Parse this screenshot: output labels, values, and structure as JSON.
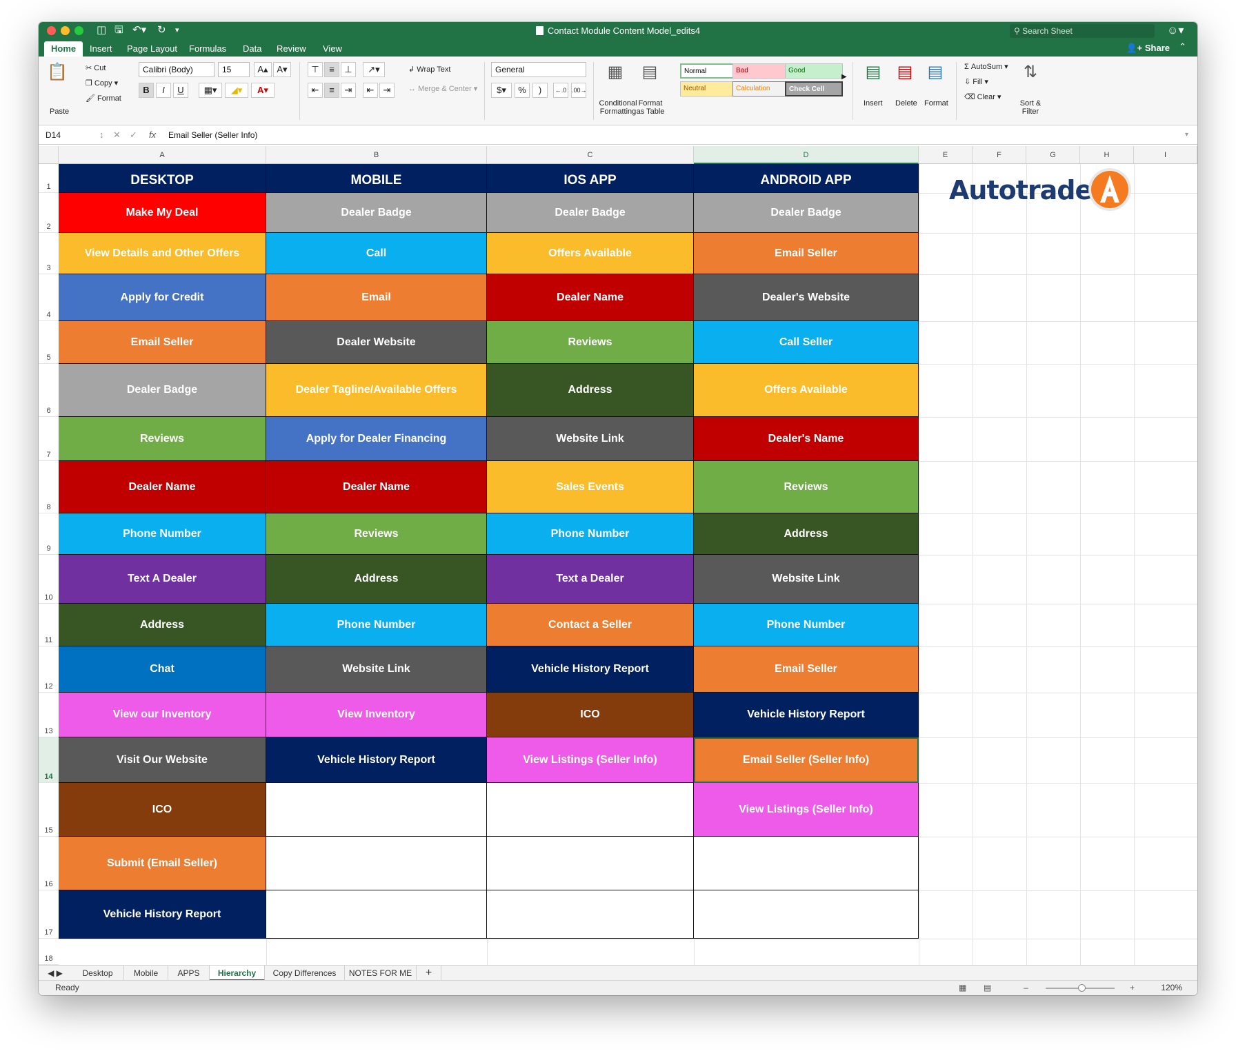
{
  "window": {
    "title": "Contact Module Content Model_edits4",
    "search_placeholder": "Search Sheet",
    "share_label": "Share",
    "menu_tabs": [
      "Home",
      "Insert",
      "Page Layout",
      "Formulas",
      "Data",
      "Review",
      "View"
    ],
    "active_tab": "Home"
  },
  "ribbon": {
    "paste": "Paste",
    "cut": "Cut",
    "copy": "Copy",
    "format_painter": "Format",
    "font_name": "Calibri (Body)",
    "font_size": "15",
    "wrap_text": "Wrap Text",
    "merge_center": "Merge & Center",
    "number_format": "General",
    "currency": "$",
    "percent": "%",
    "comma": ")",
    "conditional_formatting_1": "Conditional",
    "conditional_formatting_2": "Formatting",
    "format_as_table_1": "Format",
    "format_as_table_2": "as Table",
    "styles": [
      "Normal",
      "Bad",
      "Good",
      "Neutral",
      "Calculation",
      "Check Cell"
    ],
    "insert": "Insert",
    "delete": "Delete",
    "format": "Format",
    "autosum": "AutoSum",
    "fill": "Fill",
    "clear": "Clear",
    "sort_filter_1": "Sort &",
    "sort_filter_2": "Filter"
  },
  "formula_bar": {
    "cell_ref": "D14",
    "fx": "fx",
    "value": "Email Seller (Seller Info)"
  },
  "columns": [
    "A",
    "B",
    "C",
    "D",
    "E",
    "F",
    "G",
    "H",
    "I"
  ],
  "selected_column": "D",
  "selected_row": "14",
  "rows": [
    "1",
    "2",
    "3",
    "4",
    "5",
    "6",
    "7",
    "8",
    "9",
    "10",
    "11",
    "12",
    "13",
    "14",
    "15",
    "16",
    "17",
    "18"
  ],
  "logo_text": "Autotrader",
  "colors": {
    "navy": "#002060",
    "red": "#ff0000",
    "darkred": "#c00000",
    "gray": "#a5a5a5",
    "darkgray": "#595959",
    "orange": "#ed7d31",
    "gold": "#fbbc2c",
    "blue": "#4472c4",
    "cyan": "#0aafef",
    "green": "#70ad47",
    "darkgreen": "#375623",
    "purple": "#7030a0",
    "medblue": "#0070c0",
    "magenta": "#ee5be9",
    "brown": "#843c0c",
    "excel_green": "#217346"
  },
  "table": {
    "headers": [
      "DESKTOP",
      "MOBILE",
      "IOS APP",
      "ANDROID APP"
    ],
    "desktop": [
      {
        "text": "Make My Deal",
        "color": "red"
      },
      {
        "text": "View Details and Other Offers",
        "color": "gold"
      },
      {
        "text": "Apply for Credit",
        "color": "blue"
      },
      {
        "text": "Email Seller",
        "color": "orange"
      },
      {
        "text": "Dealer Badge",
        "color": "gray"
      },
      {
        "text": "Reviews",
        "color": "green"
      },
      {
        "text": "Dealer Name",
        "color": "darkred"
      },
      {
        "text": "Phone Number",
        "color": "cyan"
      },
      {
        "text": "Text A Dealer",
        "color": "purple"
      },
      {
        "text": "Address",
        "color": "darkgreen"
      },
      {
        "text": "Chat",
        "color": "medblue"
      },
      {
        "text": "View our Inventory",
        "color": "magenta"
      },
      {
        "text": "Visit Our Website",
        "color": "darkgray"
      },
      {
        "text": "ICO",
        "color": "brown"
      },
      {
        "text": "Submit (Email Seller)",
        "color": "orange"
      },
      {
        "text": "Vehicle History Report",
        "color": "navy"
      }
    ],
    "mobile": [
      {
        "text": "Dealer Badge",
        "color": "gray"
      },
      {
        "text": "Call",
        "color": "cyan"
      },
      {
        "text": "Email",
        "color": "orange"
      },
      {
        "text": "Dealer Website",
        "color": "darkgray"
      },
      {
        "text": "Dealer Tagline/Available Offers",
        "color": "gold"
      },
      {
        "text": "Apply for Dealer Financing",
        "color": "blue"
      },
      {
        "text": "Dealer Name",
        "color": "darkred"
      },
      {
        "text": "Reviews",
        "color": "green"
      },
      {
        "text": "Address",
        "color": "darkgreen"
      },
      {
        "text": "Phone Number",
        "color": "cyan"
      },
      {
        "text": "Website Link",
        "color": "darkgray"
      },
      {
        "text": "View Inventory",
        "color": "magenta"
      },
      {
        "text": "Vehicle History Report",
        "color": "navy"
      }
    ],
    "ios": [
      {
        "text": "Dealer Badge",
        "color": "gray"
      },
      {
        "text": "Offers Available",
        "color": "gold"
      },
      {
        "text": "Dealer Name",
        "color": "darkred"
      },
      {
        "text": "Reviews",
        "color": "green"
      },
      {
        "text": "Address",
        "color": "darkgreen"
      },
      {
        "text": "Website Link",
        "color": "darkgray"
      },
      {
        "text": "Sales Events",
        "color": "gold"
      },
      {
        "text": "Phone Number",
        "color": "cyan"
      },
      {
        "text": "Text a Dealer",
        "color": "purple"
      },
      {
        "text": "Contact a Seller",
        "color": "orange"
      },
      {
        "text": "Vehicle History Report",
        "color": "navy"
      },
      {
        "text": "ICO",
        "color": "brown"
      },
      {
        "text": "View Listings (Seller Info)",
        "color": "magenta"
      }
    ],
    "android": [
      {
        "text": "Dealer Badge",
        "color": "gray"
      },
      {
        "text": "Email Seller",
        "color": "orange"
      },
      {
        "text": "Dealer's Website",
        "color": "darkgray"
      },
      {
        "text": "Call Seller",
        "color": "cyan"
      },
      {
        "text": "Offers Available",
        "color": "gold"
      },
      {
        "text": "Dealer's Name",
        "color": "darkred"
      },
      {
        "text": "Reviews",
        "color": "green"
      },
      {
        "text": "Address",
        "color": "darkgreen"
      },
      {
        "text": "Website Link",
        "color": "darkgray"
      },
      {
        "text": "Phone Number",
        "color": "cyan"
      },
      {
        "text": "Email Seller",
        "color": "orange"
      },
      {
        "text": "Vehicle History Report",
        "color": "navy"
      },
      {
        "text": "Email Seller (Seller Info)",
        "color": "orange"
      },
      {
        "text": "View Listings (Seller Info)",
        "color": "magenta"
      }
    ]
  },
  "sheet_tabs": [
    "Desktop",
    "Mobile",
    "APPS",
    "Hierarchy",
    "Copy Differences",
    "NOTES FOR ME"
  ],
  "active_sheet": "Hierarchy",
  "add_sheet": "+",
  "status": {
    "text": "Ready",
    "zoom": "120%"
  }
}
